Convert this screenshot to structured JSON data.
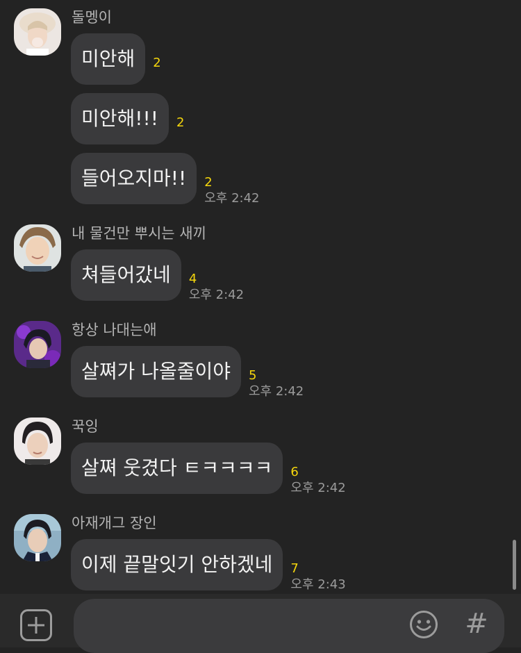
{
  "messages": [
    {
      "sender": "돌멩이",
      "bubbles": [
        {
          "text": "미안해",
          "unread": "2",
          "time": ""
        },
        {
          "text": "미안해!!!",
          "unread": "2",
          "time": ""
        },
        {
          "text": "들어오지마!!",
          "unread": "2",
          "time": "오후 2:42"
        }
      ]
    },
    {
      "sender": "내 물건만 뿌시는 새끼",
      "bubbles": [
        {
          "text": "쳐들어갔네",
          "unread": "4",
          "time": "오후 2:42"
        }
      ]
    },
    {
      "sender": "항상 나대는애",
      "bubbles": [
        {
          "text": "살쪄가 나올줄이야",
          "unread": "5",
          "time": "오후 2:42"
        }
      ]
    },
    {
      "sender": "꾹잉",
      "bubbles": [
        {
          "text": "살쪄 웃겼다 ㅌㅋㅋㅋㅋ",
          "unread": "6",
          "time": "오후 2:42"
        }
      ]
    },
    {
      "sender": "아재개그 장인",
      "bubbles": [
        {
          "text": "이제 끝말잇기 안하겠네",
          "unread": "7",
          "time": "오후 2:43"
        }
      ]
    }
  ],
  "composer": {
    "input_value": "",
    "placeholder": "",
    "hashtag_label": "#"
  },
  "colors": {
    "background": "#232323",
    "bubble": "#3a3a3c",
    "unread": "#f5d60c",
    "composer": "#2a2a2a"
  }
}
